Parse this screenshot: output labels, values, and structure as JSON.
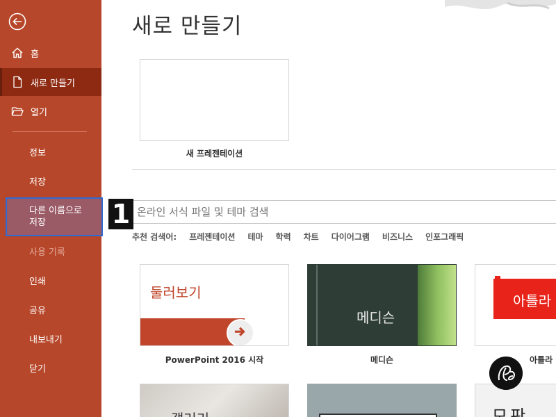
{
  "sidebar": {
    "items": [
      {
        "label": "홈"
      },
      {
        "label": "새로 만들기"
      },
      {
        "label": "열기"
      },
      {
        "label": "정보"
      },
      {
        "label": "저장"
      },
      {
        "label": "다른 이름으로 저장"
      },
      {
        "label": "사용 기록"
      },
      {
        "label": "인쇄"
      },
      {
        "label": "공유"
      },
      {
        "label": "내보내기"
      },
      {
        "label": "닫기"
      }
    ]
  },
  "main": {
    "title": "새로 만들기",
    "blank_label": "새 프레젠테이션",
    "search_placeholder": "온라인 서식 파일 및 테마 검색",
    "suggest_label": "추천 검색어:",
    "suggestions": [
      "프레젠테이션",
      "테마",
      "학력",
      "차트",
      "다이어그램",
      "비즈니스",
      "인포그래픽"
    ],
    "templates": [
      {
        "name": "PowerPoint 2016 시작",
        "thumb_text": "둘러보기"
      },
      {
        "name": "메디슨",
        "thumb_text": "메디슨"
      },
      {
        "name": "아틀라",
        "thumb_text": "아틀라"
      },
      {
        "thumb_text": "갤러리"
      },
      {
        "thumb_text": "모판"
      }
    ]
  },
  "callout": "1",
  "colors": {
    "sidebar": "#b7472a",
    "accent": "#c0452a",
    "selection_border": "#2f6bd1"
  }
}
